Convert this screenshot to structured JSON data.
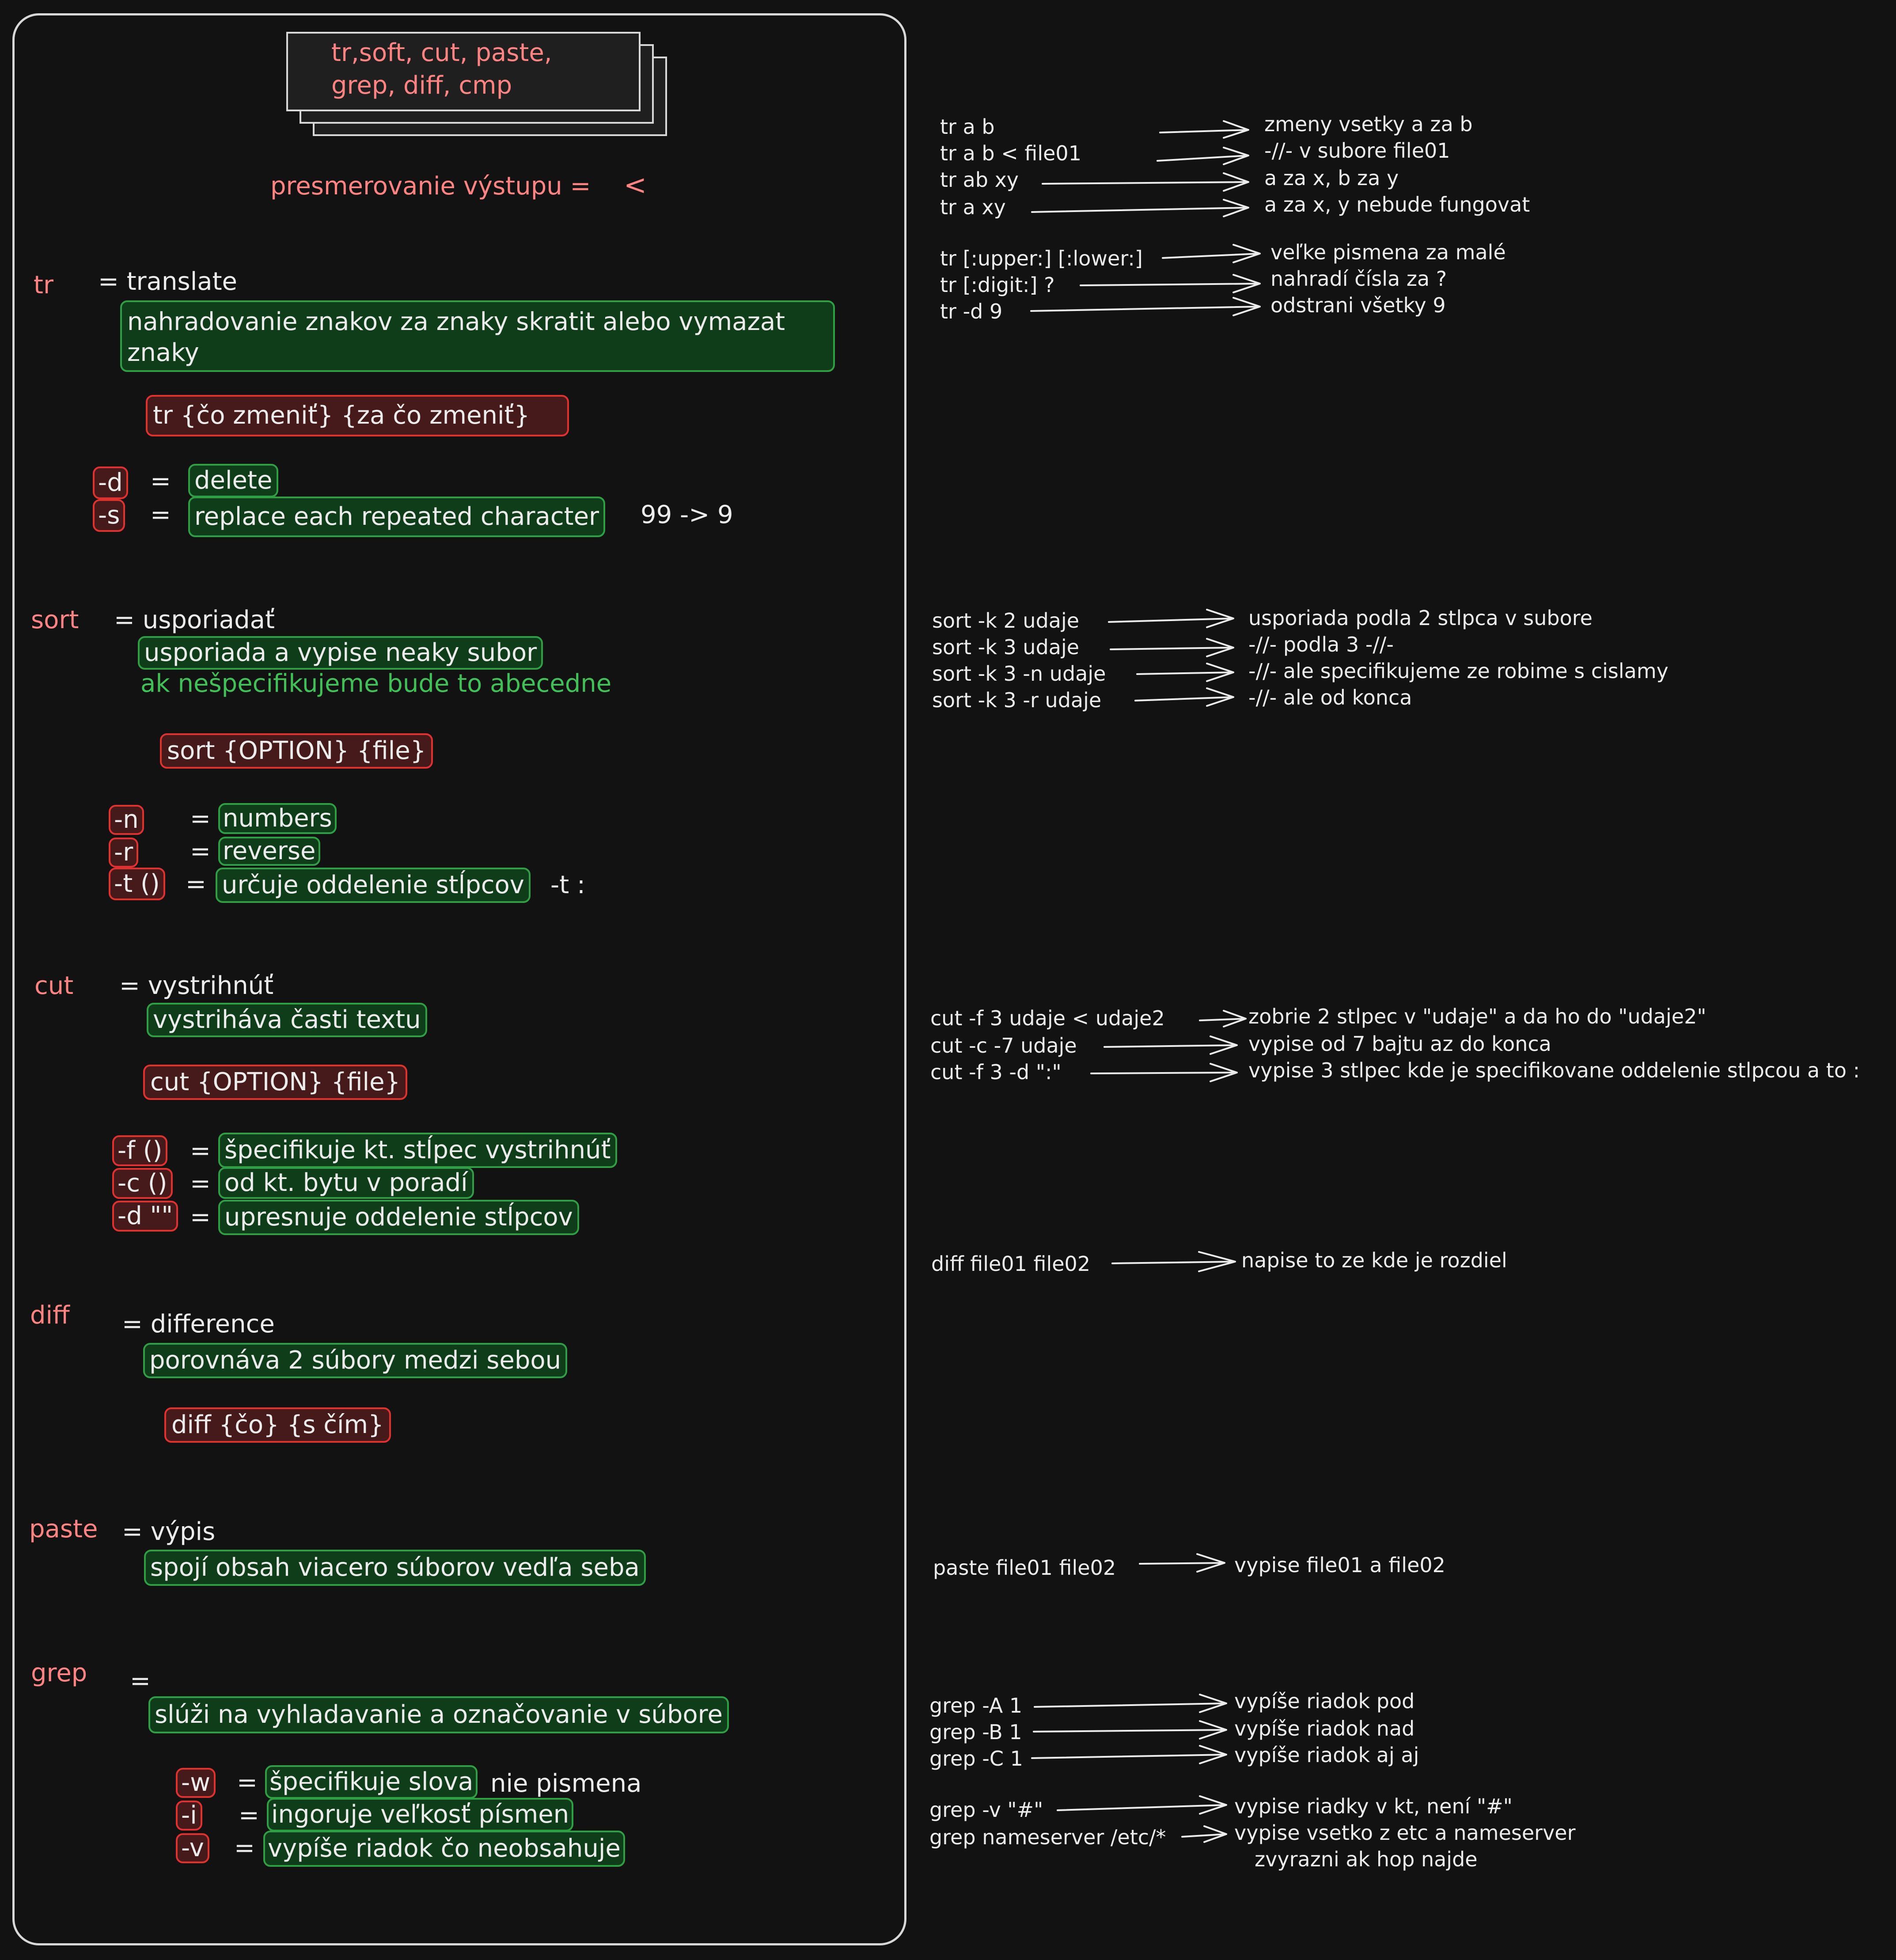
{
  "title": {
    "line1": "tr,soft, cut, paste,",
    "line2": "grep, diff, cmp"
  },
  "redirect": {
    "label": "presmerovanie výstupu =",
    "symbol": "<"
  },
  "tr": {
    "name": "tr",
    "meaning": "= translate",
    "desc": "nahradovanie znakov za znaky skratit alebo vymazat znaky",
    "syntax": "tr {čo zmeniť} {za čo zmeniť}",
    "options": [
      {
        "flag": "-d",
        "eq": "=",
        "desc": "delete",
        "note": ""
      },
      {
        "flag": "-s",
        "eq": "=",
        "desc": "replace each repeated character",
        "note": "99 -> 9"
      }
    ]
  },
  "sort": {
    "name": "sort",
    "meaning": "= usporiadať",
    "desc": "usporiada a vypise neaky subor",
    "note": "ak nešpecifikujeme bude to abecedne",
    "syntax": "sort {OPTION} {file}",
    "options": [
      {
        "flag": "-n",
        "eq": "=",
        "desc": "numbers",
        "note": ""
      },
      {
        "flag": "-r",
        "eq": "=",
        "desc": "reverse",
        "note": ""
      },
      {
        "flag": "-t ()",
        "eq": "=",
        "desc": "určuje oddelenie stĺpcov",
        "note": "-t :"
      }
    ]
  },
  "cut": {
    "name": "cut",
    "meaning": "= vystrihnúť",
    "desc": "vystriháva časti textu",
    "syntax": "cut {OPTION} {file}",
    "options": [
      {
        "flag": "-f ()",
        "eq": "=",
        "desc": "špecifikuje kt. stĺpec vystrihnúť",
        "note": ""
      },
      {
        "flag": "-c ()",
        "eq": "=",
        "desc": "od kt. bytu v poradí",
        "note": ""
      },
      {
        "flag": "-d \"\"",
        "eq": "=",
        "desc": "upresnuje oddelenie stĺpcov",
        "note": ""
      }
    ]
  },
  "diff": {
    "name": "diff",
    "meaning": "= difference",
    "desc": "porovnáva 2 súbory medzi sebou",
    "syntax": "diff {čo} {s čím}"
  },
  "paste": {
    "name": "paste",
    "meaning": "= výpis",
    "desc": "spojí obsah viacero súborov vedľa seba"
  },
  "grep": {
    "name": "grep",
    "meaning": "=",
    "desc": "slúži na vyhladavanie a označovanie v súbore",
    "options": [
      {
        "flag": "-w",
        "eq": "=",
        "desc": "špecifikuje slova",
        "note": "nie pismena"
      },
      {
        "flag": "-i",
        "eq": "=",
        "desc": "ingoruje veľkosť písmen",
        "note": ""
      },
      {
        "flag": "-v",
        "eq": "=",
        "desc": "vypíše riadok čo neobsahuje",
        "note": ""
      }
    ]
  },
  "examples": {
    "tr1": [
      {
        "cmd": "tr a b",
        "result": "zmeny vsetky a za b"
      },
      {
        "cmd": "tr a b < file01",
        "result": "-//- v subore file01"
      },
      {
        "cmd": "tr ab xy",
        "result": "a za x, b za y"
      },
      {
        "cmd": "tr a xy",
        "result": "a za x, y nebude fungovat"
      }
    ],
    "tr2": [
      {
        "cmd": "tr [:upper:] [:lower:]",
        "result": "veľke pismena za malé"
      },
      {
        "cmd": "tr [:digit:] ?",
        "result": "nahradí čísla za ?"
      },
      {
        "cmd": "tr -d 9",
        "result": "odstrani všetky 9"
      }
    ],
    "sort": [
      {
        "cmd": "sort -k 2 udaje",
        "result": "usporiada podla 2 stlpca v subore"
      },
      {
        "cmd": "sort -k 3 udaje",
        "result": "-//- podla 3 -//-"
      },
      {
        "cmd": "sort -k 3 -n udaje",
        "result": "-//- ale specifikujeme ze robime s cislamy"
      },
      {
        "cmd": "sort -k 3 -r udaje",
        "result": "-//- ale od konca"
      }
    ],
    "cut": [
      {
        "cmd": "cut -f 3 udaje < udaje2",
        "result": "zobrie 2 stlpec v \"udaje\" a da ho do \"udaje2\""
      },
      {
        "cmd": "cut -c -7 udaje",
        "result": "vypise od 7 bajtu az do konca"
      },
      {
        "cmd": "cut -f 3 -d \":\"",
        "result": "vypise 3 stlpec kde je specifikovane oddelenie stlpcou a to :"
      }
    ],
    "diff": [
      {
        "cmd": "diff file01 file02",
        "result": "napise to ze kde je rozdiel"
      }
    ],
    "paste": [
      {
        "cmd": "paste file01 file02",
        "result": "vypise file01 a file02"
      }
    ],
    "grep1": [
      {
        "cmd": "grep -A 1",
        "result": "vypíše riadok pod"
      },
      {
        "cmd": "grep -B 1",
        "result": "vypíše riadok nad"
      },
      {
        "cmd": "grep -C 1",
        "result": "vypíše riadok aj aj"
      }
    ],
    "grep2": [
      {
        "cmd": "grep -v \"#\"",
        "result": "vypise riadky v kt, není \"#\""
      },
      {
        "cmd": "grep nameserver /etc/*",
        "result": "vypise vsetko z etc a nameserver"
      }
    ],
    "grep2_extra": "zvyrazni ak hop najde"
  },
  "colors": {
    "background": "#121212",
    "command_red": "#ff8383",
    "box_green": "#2f9e44",
    "box_red": "#e03131",
    "text_white": "#ececec"
  }
}
